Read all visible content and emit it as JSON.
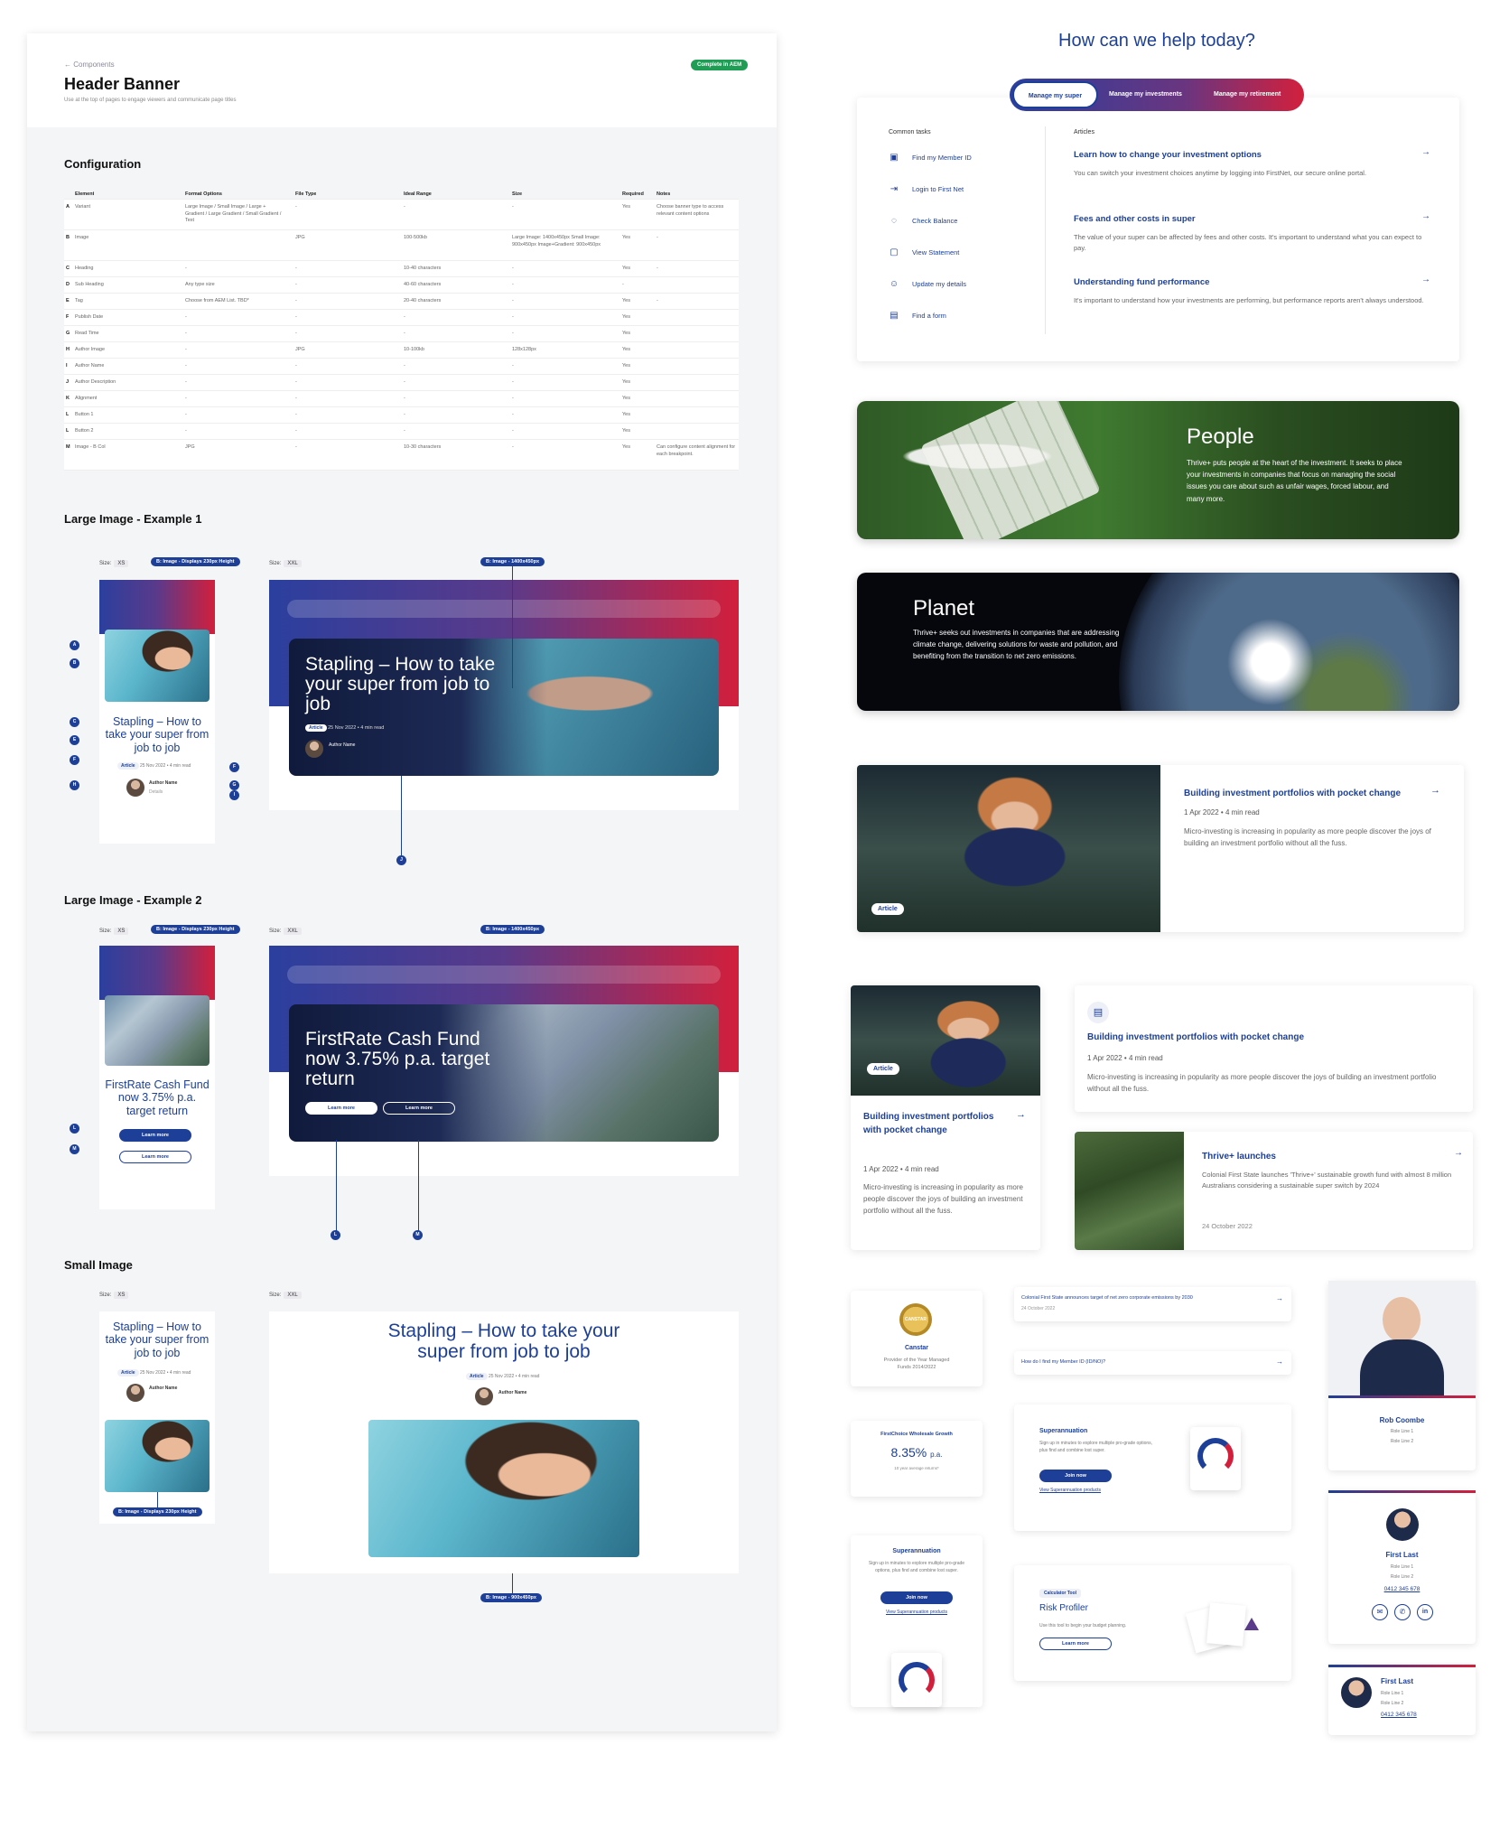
{
  "doc": {
    "breadcrumb": "← Components",
    "title": "Header Banner",
    "subtitle": "Use at the top of pages to engage viewers and communicate page titles",
    "status": "Complete in AEM",
    "sections": {
      "configuration": "Configuration",
      "large1": "Large Image - Example 1",
      "large2": "Large Image - Example 2",
      "small": "Small Image"
    },
    "table": {
      "headers": [
        "Element",
        "Format Options",
        "File Type",
        "Ideal Range",
        "Size",
        "Required",
        "Notes"
      ],
      "rows": [
        {
          "key": "A",
          "element": "Variant",
          "format": "Large Image / Small Image / Large + Gradient / Large Gradient / Small Gradient / Text",
          "file": "-",
          "range": "-",
          "size": "-",
          "req": "Yes",
          "notes": "Choose banner type to access relevant content options"
        },
        {
          "key": "B",
          "element": "Image",
          "format": "",
          "file": "JPG",
          "range": "100-500kb",
          "size": "Large Image: 1400x450px Small Image: 900x450px Image+Gradient: 900x450px",
          "req": "Yes",
          "notes": "-"
        },
        {
          "key": "C",
          "element": "Heading",
          "format": "-",
          "file": "-",
          "range": "10-40 characters",
          "size": "-",
          "req": "Yes",
          "notes": "-"
        },
        {
          "key": "D",
          "element": "Sub Heading",
          "format": "Any type size",
          "file": "-",
          "range": "40-60 characters",
          "size": "-",
          "req": "-",
          "notes": ""
        },
        {
          "key": "E",
          "element": "Tag",
          "format": "Choose from AEM List. TBD*",
          "file": "-",
          "range": "20-40 characters",
          "size": "-",
          "req": "Yes",
          "notes": "-"
        },
        {
          "key": "F",
          "element": "Publish Date",
          "format": "-",
          "file": "-",
          "range": "-",
          "size": "-",
          "req": "Yes",
          "notes": ""
        },
        {
          "key": "G",
          "element": "Read Time",
          "format": "-",
          "file": "-",
          "range": "-",
          "size": "-",
          "req": "Yes",
          "notes": ""
        },
        {
          "key": "H",
          "element": "Author Image",
          "format": "-",
          "file": "JPG",
          "range": "10-100kb",
          "size": "128x128px",
          "req": "Yes",
          "notes": ""
        },
        {
          "key": "I",
          "element": "Author Name",
          "format": "-",
          "file": "-",
          "range": "-",
          "size": "-",
          "req": "Yes",
          "notes": ""
        },
        {
          "key": "J",
          "element": "Author Description",
          "format": "-",
          "file": "-",
          "range": "-",
          "size": "-",
          "req": "Yes",
          "notes": ""
        },
        {
          "key": "K",
          "element": "Alignment",
          "format": "-",
          "file": "-",
          "range": "-",
          "size": "-",
          "req": "Yes",
          "notes": ""
        },
        {
          "key": "L",
          "element": "Button 1",
          "format": "-",
          "file": "-",
          "range": "-",
          "size": "-",
          "req": "Yes",
          "notes": ""
        },
        {
          "key": "L",
          "element": "Button 2",
          "format": "-",
          "file": "-",
          "range": "-",
          "size": "-",
          "req": "Yes",
          "notes": ""
        },
        {
          "key": "M",
          "element": "Image - B Col",
          "format": "JPG",
          "file": "-",
          "range": "10-30 characters",
          "size": "-",
          "req": "Yes",
          "notes": "Can configure content alignment for each breakpoint."
        }
      ]
    },
    "size_label": "Size:",
    "size_xs": "XS",
    "size_xxl": "XXL",
    "pill_xs": "B: Image - Displays 230px Height",
    "pill_xxl": "B: Image - 1400x450px",
    "pill_small_xxl": "B: Image - 900x450px",
    "hero1_title": "Stapling – How to take your super from job to job",
    "hero2_title": "FirstRate Cash Fund now 3.75% p.a. target return",
    "small_title": "Stapling – How to take your super from job to job",
    "tag": "Article",
    "date_meta": "25 Nov 2022 • 4 min read",
    "author_name": "Author Name",
    "author_details": "Details",
    "learn_more": "Learn more",
    "dots": {
      "A": "A",
      "B": "B",
      "C": "C",
      "D": "D",
      "E": "E",
      "F": "F",
      "G": "G",
      "H": "H",
      "I": "I",
      "J": "J",
      "L": "L",
      "M": "M"
    }
  },
  "help": {
    "title": "How can we help today?",
    "tabs": [
      "Manage my super",
      "Manage my investments",
      "Manage my retirement"
    ],
    "common_tasks_label": "Common tasks",
    "articles_label": "Articles",
    "tasks": [
      {
        "label": "Find my Member ID",
        "icon": "id-icon"
      },
      {
        "label": "Login to First Net",
        "icon": "login-icon"
      },
      {
        "label": "Check Balance",
        "icon": "balance-icon"
      },
      {
        "label": "View Statement",
        "icon": "document-icon"
      },
      {
        "label": "Update my details",
        "icon": "user-edit-icon"
      },
      {
        "label": "Find a form",
        "icon": "form-icon"
      }
    ],
    "articles": [
      {
        "title": "Learn how to change your investment options",
        "desc": "You can switch your investment choices anytime by logging into FirstNet, our secure online portal."
      },
      {
        "title": "Fees and other costs in super",
        "desc": "The value of your super can be affected by fees and other costs. It's important to understand what you can expect to pay."
      },
      {
        "title": "Understanding fund performance",
        "desc": "It's important to understand how your investments are performing, but performance reports aren't always understood."
      }
    ]
  },
  "banners": {
    "people_title": "People",
    "people_text": "Thrive+ puts people at the heart of the investment. It seeks to place your investments in companies that focus on managing the social issues you care about such as unfair wages, forced labour, and many more.",
    "planet_title": "Planet",
    "planet_text": "Thrive+ seeks out investments in companies that are addressing climate change, delivering solutions for waste and pollution, and benefiting from the transition to net zero emissions."
  },
  "cards": {
    "pocket_title": "Building investment portfolios with pocket change",
    "pocket_date": "1 Apr 2022",
    "pocket_read": "4 min read",
    "pocket_text": "Micro-investing is increasing in popularity as more people discover the joys of building an investment portfolio without all the fuss.",
    "article_chip": "Article",
    "thrive_title": "Thrive+ launches",
    "thrive_text": "Colonial First State launches 'Thrive+' sustainable growth fund with almost 8 million Australians considering a sustainable super switch by 2024",
    "thrive_date": "24 October 2022",
    "canstar_title": "Canstar",
    "canstar_text": "Provider of the Year Managed Funds 2014/2022",
    "canstar_seal": "CANSTAR",
    "news1_title": "Colonial First State announces target of net zero corporate emissions by 2030",
    "news1_date": "24 October 2022",
    "news2_title": "How do I find my Member ID (ID/NO)?",
    "fc_title": "FirstChoice Wholesale Growth",
    "fc_value": "8.35%",
    "fc_unit": "p.a.",
    "fc_sub": "10 year average returns*",
    "super_title": "Superannuation",
    "super_text": "Sign up in minutes to explore multiple pro-grade options, plus find and combine lost super.",
    "join_now": "Join now",
    "view_super": "View Superannuation products",
    "calc_chip": "Calculator Tool",
    "risk_title": "Risk Profiler",
    "risk_text": "Use this tool to begin your budget planning.",
    "learn_more": "Learn more",
    "rob_name": "Rob Coombe",
    "role1": "Role Line 1",
    "role2": "Role Line 2",
    "first_last": "First Last",
    "phone": "0412 345 678"
  },
  "colors": {
    "brand_blue": "#1d3f97",
    "brand_red": "#d21f3c",
    "green": "#1f9d55"
  }
}
